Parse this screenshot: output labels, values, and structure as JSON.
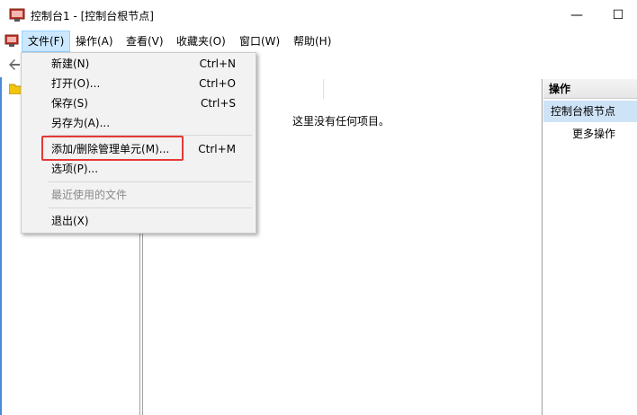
{
  "window": {
    "title": "控制台1 - [控制台根节点]",
    "minimize_symbol": "—",
    "maximize_symbol": "☐"
  },
  "menubar": {
    "items": [
      {
        "label": "文件(F)"
      },
      {
        "label": "操作(A)"
      },
      {
        "label": "查看(V)"
      },
      {
        "label": "收藏夹(O)"
      },
      {
        "label": "窗口(W)"
      },
      {
        "label": "帮助(H)"
      }
    ]
  },
  "file_menu": {
    "items": [
      {
        "label": "新建(N)",
        "shortcut": "Ctrl+N"
      },
      {
        "label": "打开(O)...",
        "shortcut": "Ctrl+O"
      },
      {
        "label": "保存(S)",
        "shortcut": "Ctrl+S"
      },
      {
        "label": "另存为(A)...",
        "shortcut": ""
      },
      {
        "label": "添加/删除管理单元(M)...",
        "shortcut": "Ctrl+M"
      },
      {
        "label": "选项(P)...",
        "shortcut": ""
      },
      {
        "label": "最近使用的文件",
        "shortcut": ""
      },
      {
        "label": "退出(X)",
        "shortcut": ""
      }
    ]
  },
  "main": {
    "empty_message": "这里没有任何项目。"
  },
  "actions_pane": {
    "header": "操作",
    "node_label": "控制台根节点",
    "more_actions": "更多操作"
  },
  "colors": {
    "highlight_border": "#e53935",
    "menu_active_bg": "#cce8ff",
    "actions_node_bg": "#cfe3f7"
  }
}
